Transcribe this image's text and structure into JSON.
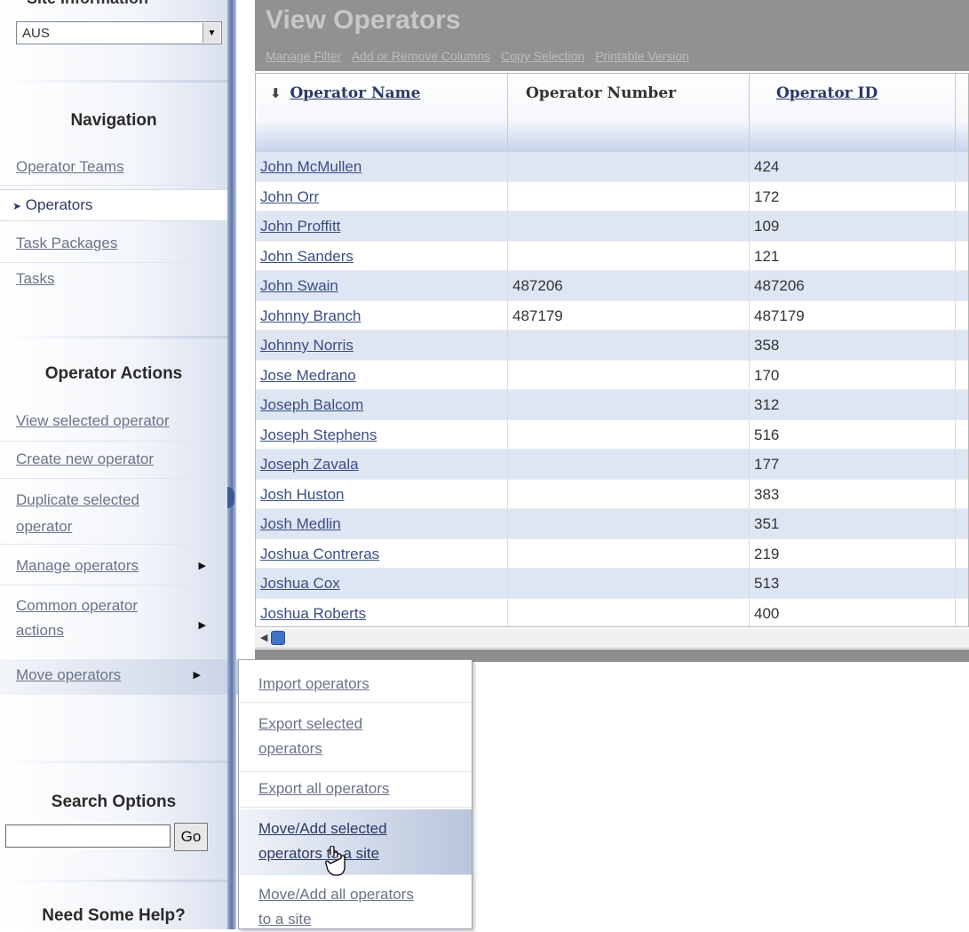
{
  "sidebar": {
    "site_section_title": "Site Information",
    "site_select_value": "AUS",
    "navigation_heading": "Navigation",
    "nav_items": [
      "Operator Teams",
      "Operators",
      "Task Packages",
      "Tasks"
    ],
    "active_nav": "Operators",
    "actions_heading": "Operator Actions",
    "action_items": {
      "view_selected": "View selected operator",
      "create_new": "Create new operator",
      "duplicate_line1": "Duplicate selected",
      "duplicate_line2": "operator",
      "manage": "Manage operators",
      "common_line1": "Common operator",
      "common_line2": "actions",
      "move": "Move operators"
    },
    "search_heading": "Search Options",
    "search_value": "",
    "search_go": "Go",
    "help_heading": "Need Some Help?"
  },
  "main": {
    "title": "View Operators",
    "toolbar": [
      "Manage Filter",
      "Add or Remove Columns",
      "Copy Selection",
      "Printable Version"
    ],
    "columns": [
      "Operator Name",
      "Operator Number",
      "Operator ID"
    ],
    "sort_indicator": "⬇",
    "rows": [
      {
        "name": "John McMullen",
        "number": "",
        "id": "424"
      },
      {
        "name": "John Orr",
        "number": "",
        "id": "172"
      },
      {
        "name": "John Proffitt",
        "number": "",
        "id": "109"
      },
      {
        "name": "John Sanders",
        "number": "",
        "id": "121"
      },
      {
        "name": "John Swain",
        "number": "487206",
        "id": "487206"
      },
      {
        "name": "Johnny Branch",
        "number": "487179",
        "id": "487179"
      },
      {
        "name": "Johnny Norris",
        "number": "",
        "id": "358"
      },
      {
        "name": "Jose Medrano",
        "number": "",
        "id": "170"
      },
      {
        "name": "Joseph Balcom",
        "number": "",
        "id": "312"
      },
      {
        "name": "Joseph Stephens",
        "number": "",
        "id": "516"
      },
      {
        "name": "Joseph Zavala",
        "number": "",
        "id": "177"
      },
      {
        "name": "Josh Huston",
        "number": "",
        "id": "383"
      },
      {
        "name": "Josh Medlin",
        "number": "",
        "id": "351"
      },
      {
        "name": "Joshua Contreras",
        "number": "",
        "id": "219"
      },
      {
        "name": "Joshua Cox",
        "number": "",
        "id": "513"
      },
      {
        "name": "Joshua Roberts",
        "number": "",
        "id": "400"
      }
    ]
  },
  "flyout": {
    "import": "Import operators",
    "export_selected_line1": "Export selected",
    "export_selected_line2": "operators",
    "export_all": "Export all operators",
    "move_selected_line1": "Move/Add selected",
    "move_selected_line2": "operators to a site",
    "move_all_line1": "Move/Add all operators",
    "move_all_line2": "to a site"
  }
}
